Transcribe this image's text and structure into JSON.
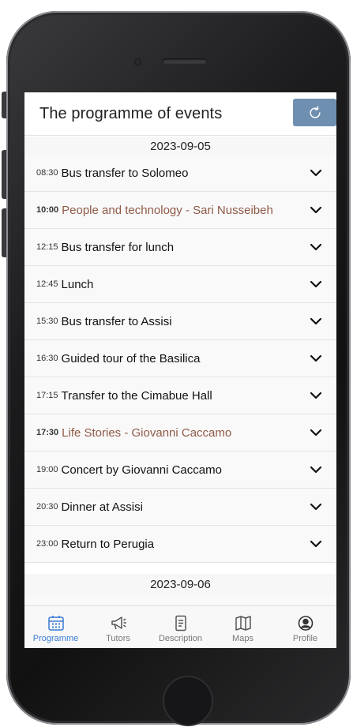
{
  "header": {
    "title": "The programme of events",
    "refresh_icon": "refresh-icon"
  },
  "days": [
    {
      "date": "2023-09-05",
      "events": [
        {
          "time": "08:30",
          "title": "Bus transfer to Solomeo",
          "highlight": false
        },
        {
          "time": "10:00",
          "title": "People and technology - Sari Nusseibeh",
          "highlight": true
        },
        {
          "time": "12:15",
          "title": "Bus transfer for lunch",
          "highlight": false
        },
        {
          "time": "12:45",
          "title": "Lunch",
          "highlight": false
        },
        {
          "time": "15:30",
          "title": "Bus transfer to Assisi",
          "highlight": false
        },
        {
          "time": "16:30",
          "title": "Guided tour of the Basilica",
          "highlight": false
        },
        {
          "time": "17:15",
          "title": "Transfer to the Cimabue Hall",
          "highlight": false
        },
        {
          "time": "17:30",
          "title": "Life Stories - Giovanni Caccamo",
          "highlight": true
        },
        {
          "time": "19:00",
          "title": "Concert by Giovanni Caccamo",
          "highlight": false
        },
        {
          "time": "20:30",
          "title": "Dinner at Assisi",
          "highlight": false
        },
        {
          "time": "23:00",
          "title": "Return to Perugia",
          "highlight": false
        }
      ]
    },
    {
      "date": "2023-09-06",
      "events": []
    }
  ],
  "tabs": [
    {
      "label": "Programme",
      "icon": "calendar-icon",
      "active": true
    },
    {
      "label": "Tutors",
      "icon": "megaphone-icon",
      "active": false
    },
    {
      "label": "Description",
      "icon": "document-icon",
      "active": false
    },
    {
      "label": "Maps",
      "icon": "map-icon",
      "active": false
    },
    {
      "label": "Profile",
      "icon": "profile-icon",
      "active": false
    }
  ],
  "colors": {
    "accent": "#3a7bd5",
    "highlight_text": "#8f5a45",
    "refresh_button": "#6e8fb0"
  }
}
